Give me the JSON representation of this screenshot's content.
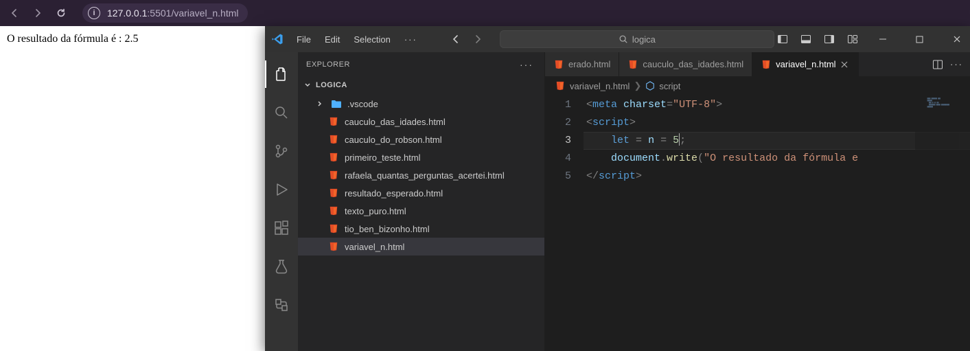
{
  "browser": {
    "url_host": "127.0.0.1",
    "url_port": ":5501",
    "url_path": "/variavel_n.html"
  },
  "page": {
    "result_text": "O resultado da fórmula é : 2.5"
  },
  "vscode": {
    "menu": [
      "File",
      "Edit",
      "Selection"
    ],
    "command_center": "logica",
    "explorer_label": "EXPLORER",
    "folder_name": "LOGICA",
    "tree": {
      "subfolder": ".vscode",
      "files": [
        "cauculo_das_idades.html",
        "cauculo_do_robson.html",
        "primeiro_teste.html",
        "rafaela_quantas_perguntas_acertei.html",
        "resultado_esperado.html",
        "texto_puro.html",
        "tio_ben_bizonho.html",
        "variavel_n.html"
      ],
      "selected": "variavel_n.html"
    },
    "tabs": [
      {
        "label": "erado.html",
        "active": false,
        "truncated": true
      },
      {
        "label": "cauculo_das_idades.html",
        "active": false,
        "truncated": false
      },
      {
        "label": "variavel_n.html",
        "active": true,
        "truncated": false
      }
    ],
    "breadcrumbs": {
      "file": "variavel_n.html",
      "symbol": "script"
    },
    "code": {
      "line_numbers": [
        "1",
        "2",
        "3",
        "4",
        "5"
      ],
      "current_line": 3,
      "l1": {
        "open": "<",
        "tag": "meta",
        "attr": "charset",
        "eq": "=",
        "val": "\"UTF-8\"",
        "close": ">"
      },
      "l2": {
        "open": "<",
        "tag": "script",
        "close": ">"
      },
      "l3": {
        "kw": "let",
        "sp1": " ",
        "eq1": "=",
        "sp2": " ",
        "name": "n",
        "sp3": " ",
        "eq2": "=",
        "sp4": " ",
        "num": "5",
        "semi": ";"
      },
      "l4": {
        "obj": "document",
        "dot": ".",
        "fn": "write",
        "open": "(",
        "str": "\"O resultado da fórmula ",
        "trail": "e"
      },
      "l5": {
        "open": "</",
        "tag": "script",
        "close": ">"
      }
    }
  }
}
